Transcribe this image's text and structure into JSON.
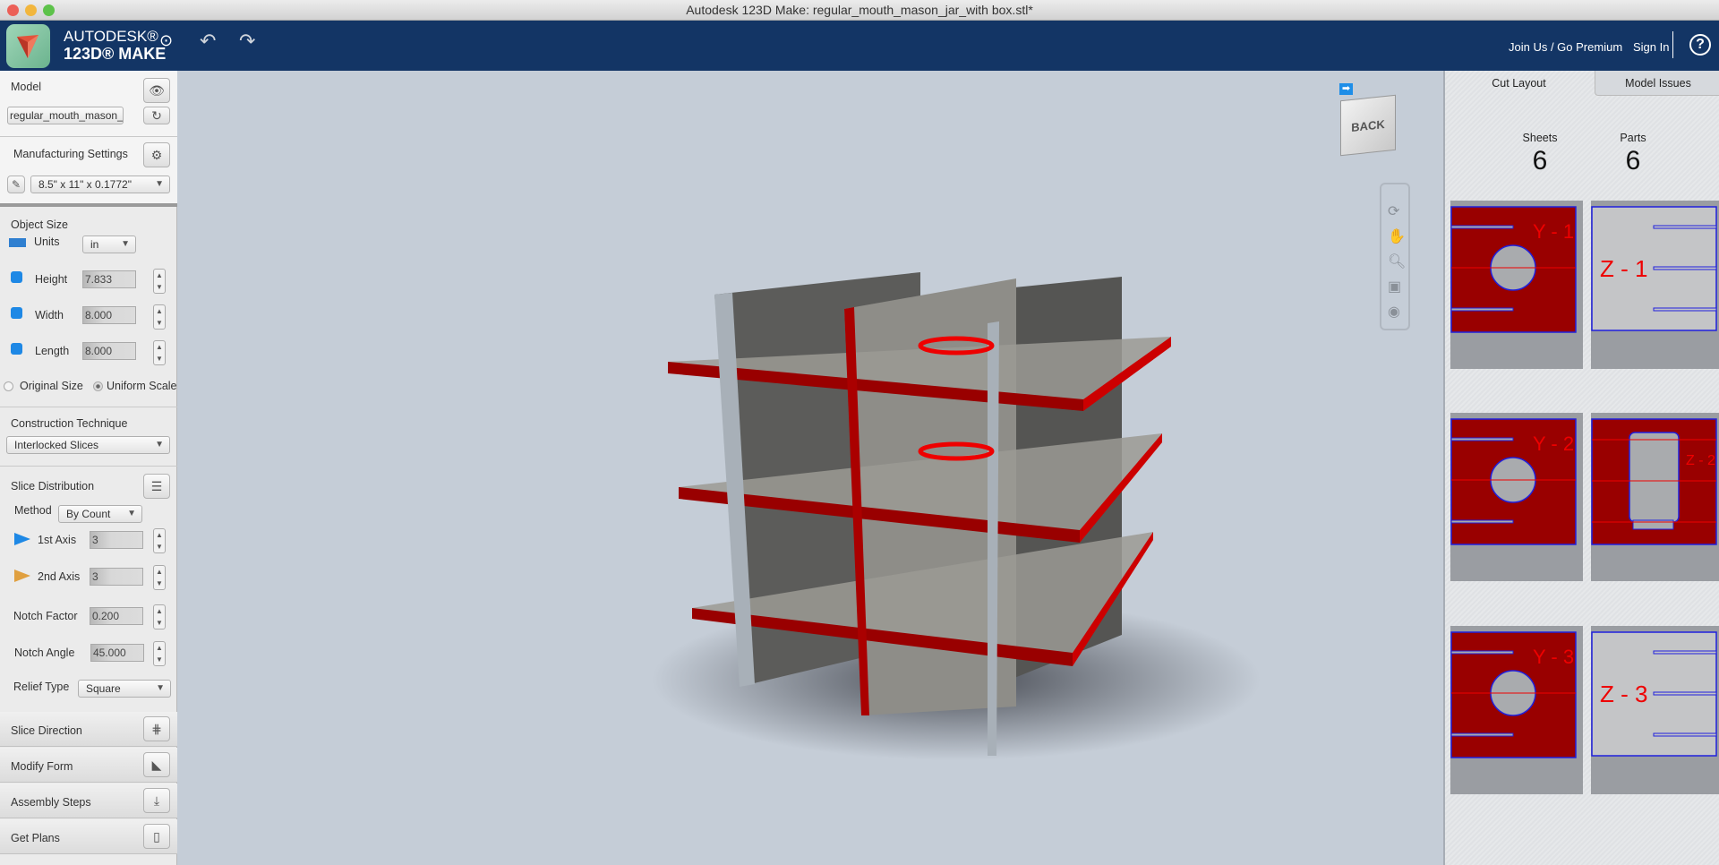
{
  "window": {
    "title": "Autodesk 123D Make: regular_mouth_mason_jar_with box.stl*"
  },
  "header": {
    "brand_line1": "AUTODESK®",
    "brand_line2": "123D® MAKE",
    "join_link": "Join Us / Go Premium",
    "sign_in": "Sign In",
    "help_icon": "?"
  },
  "model": {
    "label": "Model",
    "file_value": "regular_mouth_mason_"
  },
  "manufacturing": {
    "label": "Manufacturing Settings",
    "sheet_size": "8.5\" x 11\" x 0.1772\""
  },
  "object_size": {
    "label": "Object Size",
    "units_label": "Units",
    "units_value": "in",
    "height_label": "Height",
    "height_value": "7.833",
    "width_label": "Width",
    "width_value": "8.000",
    "length_label": "Length",
    "length_value": "8.000",
    "original_size": "Original Size",
    "uniform_scale": "Uniform Scale",
    "uniform_selected": true
  },
  "construction": {
    "label": "Construction Technique",
    "value": "Interlocked Slices"
  },
  "slice_distribution": {
    "label": "Slice Distribution",
    "method_label": "Method",
    "method_value": "By Count",
    "axis1_label": "1st Axis",
    "axis1_value": "3",
    "axis2_label": "2nd Axis",
    "axis2_value": "3",
    "notch_factor_label": "Notch Factor",
    "notch_factor_value": "0.200",
    "notch_angle_label": "Notch Angle",
    "notch_angle_value": "45.000",
    "relief_label": "Relief Type",
    "relief_value": "Square"
  },
  "bars": {
    "slice_direction": "Slice Direction",
    "modify_form": "Modify Form",
    "assembly_steps": "Assembly Steps",
    "get_plans": "Get Plans"
  },
  "viewcube": {
    "face": "BACK"
  },
  "right_panel": {
    "tabs": [
      "Cut Layout",
      "Model Issues"
    ],
    "active_tab": "Cut Layout",
    "sheets_label": "Sheets",
    "sheets_value": "6",
    "parts_label": "Parts",
    "parts_value": "6",
    "sheets": [
      {
        "label": "Y-1",
        "type": "Y"
      },
      {
        "label": "Z-1",
        "type": "Z-empty"
      },
      {
        "label": "Y-2",
        "type": "Y"
      },
      {
        "label": "Z-2",
        "type": "Z-jar"
      },
      {
        "label": "Y-3",
        "type": "Y"
      },
      {
        "label": "Z-3",
        "type": "Z-empty"
      }
    ]
  },
  "colors": {
    "header": "#133565",
    "slice_red": "#990000",
    "outline_blue": "#2020dd"
  }
}
